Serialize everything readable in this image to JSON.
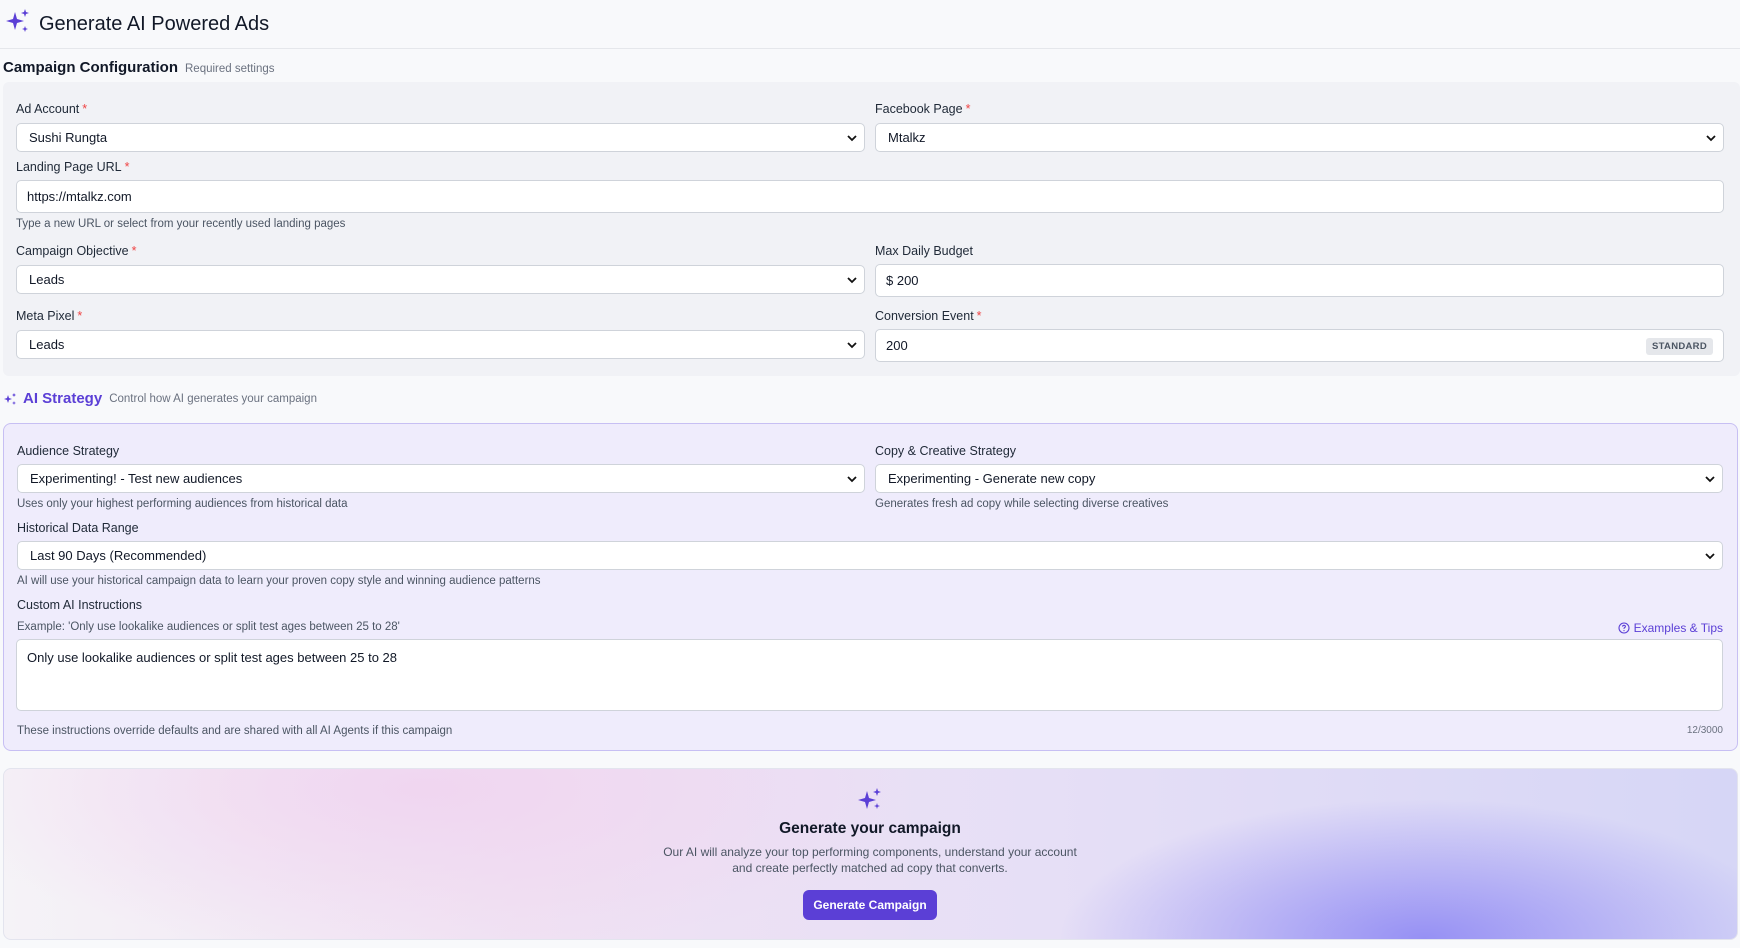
{
  "header": {
    "title": "Generate AI Powered Ads",
    "icon": "sparkles-icon"
  },
  "campaign_config": {
    "title": "Campaign Configuration",
    "subtitle": "Required settings",
    "ad_account": {
      "label": "Ad Account",
      "value": "Sushi Rungta"
    },
    "facebook_page": {
      "label": "Facebook Page",
      "value": "Mtalkz"
    },
    "landing_page": {
      "label": "Landing Page URL",
      "value": "https://mtalkz.com",
      "help": "Type a new URL or select from your recently used landing pages"
    },
    "objective": {
      "label": "Campaign Objective",
      "value": "Leads"
    },
    "budget": {
      "label": "Max Daily Budget",
      "value": "$ 200"
    },
    "pixel": {
      "label": "Meta Pixel",
      "value": "Leads"
    },
    "conversion": {
      "label": "Conversion Event",
      "value": "200",
      "badge": "STANDARD"
    },
    "required_mark": "*"
  },
  "ai_strategy": {
    "title": "AI Strategy",
    "subtitle": "Control how AI generates your campaign",
    "audience": {
      "label": "Audience Strategy",
      "value": "Experimenting! - Test new audiences",
      "help": "Uses only your highest performing audiences from historical data"
    },
    "copy": {
      "label": "Copy & Creative Strategy",
      "value": "Experimenting - Generate new copy",
      "help": "Generates fresh ad copy while selecting diverse creatives"
    },
    "history": {
      "label": "Historical Data Range",
      "value": "Last 90 Days (Recommended)",
      "help": "AI will use your historical campaign data to learn your proven copy style and winning audience patterns"
    },
    "custom": {
      "label": "Custom AI Instructions",
      "example": "Example: 'Only use lookalike audiences or split test ages between 25 to 28'",
      "tips_link": "Examples & Tips",
      "value": "Only use lookalike audiences or split test ages between 25 to 28",
      "footer": "These instructions override defaults and are shared with all AI Agents if this campaign",
      "count": "12/3000"
    }
  },
  "cta": {
    "title": "Generate your campaign",
    "desc_line1": "Our AI will analyze your top performing components, understand your account",
    "desc_line2": "and create perfectly matched ad copy that converts.",
    "button": "Generate Campaign"
  },
  "colors": {
    "accent": "#5b3fd6",
    "required": "#ef4444",
    "ai_panel_bg": "#efecfc"
  }
}
